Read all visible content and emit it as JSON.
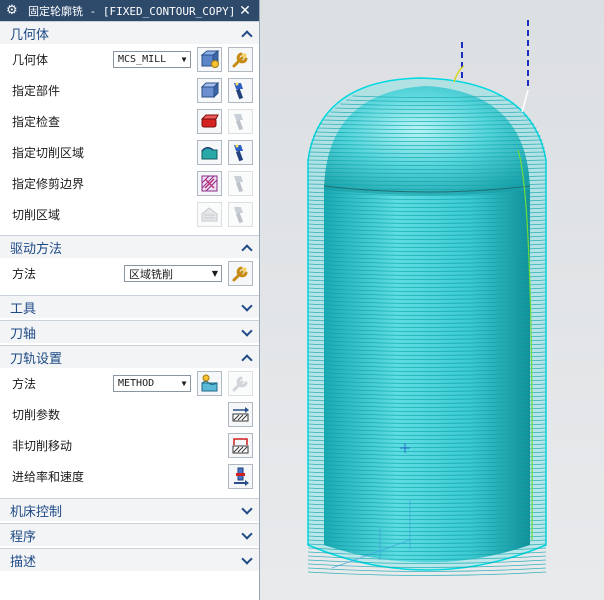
{
  "dialog": {
    "title": "固定轮廓铣 - [FIXED_CONTOUR_COPY]",
    "close_label": "✕",
    "gear_label": "⚙"
  },
  "geometry": {
    "header": "几何体",
    "geometry_label": "几何体",
    "geometry_value": "MCS_MILL",
    "specify_part": "指定部件",
    "specify_check": "指定检查",
    "specify_cut_area": "指定切削区域",
    "specify_trim": "指定修剪边界",
    "cut_area": "切削区域"
  },
  "drive": {
    "header": "驱动方法",
    "method_label": "方法",
    "method_value": "区域铣削"
  },
  "tools": {
    "header": "工具"
  },
  "axis": {
    "header": "刀轴"
  },
  "path": {
    "header": "刀轨设置",
    "method_label": "方法",
    "method_value": "METHOD",
    "cut_params": "切削参数",
    "non_cut": "非切削移动",
    "feeds": "进给率和速度"
  },
  "machine": {
    "header": "机床控制"
  },
  "program": {
    "header": "程序"
  },
  "description": {
    "header": "描述"
  },
  "colors": {
    "title_bg": "#2d4a6b",
    "group_text": "#1f4a86",
    "toolpath": "#00d8e0",
    "model": "#4fd1d8"
  }
}
